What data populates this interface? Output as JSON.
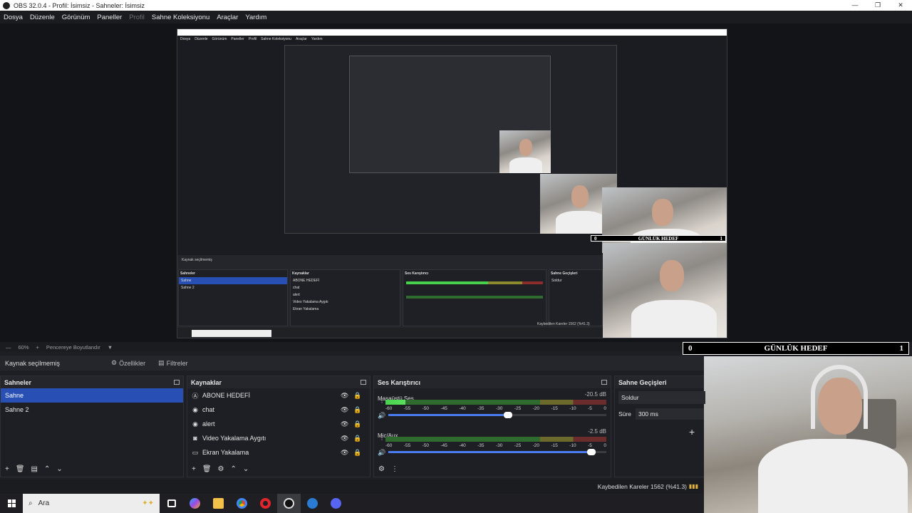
{
  "window": {
    "title": "OBS 32.0.4 - Profil: İsimsiz - Sahneler: İsimsiz",
    "controls": [
      "—",
      "❐",
      "✕"
    ]
  },
  "menu": [
    "Dosya",
    "Düzenle",
    "Görünüm",
    "Paneller",
    "Profil",
    "Sahne Koleksiyonu",
    "Araçlar",
    "Yardım"
  ],
  "preview": {
    "zoom": "60%",
    "fit": "Pencereye Boyutlandır",
    "goal_left": "0",
    "goal_title": "GÜNLÜK HEDEF",
    "goal_right": "1"
  },
  "source_bar": {
    "no_source": "Kaynak seçilmemiş",
    "properties": "Özellikler",
    "filters": "Filtreler"
  },
  "scenes": {
    "title": "Sahneler",
    "items": [
      "Sahne",
      "Sahne 2"
    ],
    "selected": 0
  },
  "sources": {
    "title": "Kaynaklar",
    "items": [
      {
        "icon": "text-icon",
        "label": "ABONE HEDEFİ"
      },
      {
        "icon": "browser-icon",
        "label": "chat"
      },
      {
        "icon": "browser-icon",
        "label": "alert"
      },
      {
        "icon": "camera-icon",
        "label": "Video Yakalama Aygıtı"
      },
      {
        "icon": "monitor-icon",
        "label": "Ekran Yakalama"
      }
    ]
  },
  "mixer": {
    "title": "Ses Karıştırıcı",
    "ticks": [
      "-60",
      "-55",
      "-50",
      "-45",
      "-40",
      "-35",
      "-30",
      "-25",
      "-20",
      "-15",
      "-10",
      "-5",
      "0"
    ],
    "channels": [
      {
        "name": "Masaüstü Ses",
        "db": "-20.5 dB",
        "level": 0.09,
        "volume": 0.55
      },
      {
        "name": "Mic/Aux",
        "db": "-2.5 dB",
        "level": 0.0,
        "volume": 0.93
      }
    ]
  },
  "transitions": {
    "title": "Sahne Geçişleri",
    "type": "Soldur",
    "duration_label": "Süre",
    "duration": "300 ms"
  },
  "status": {
    "dropped": "Kaybedilen Kareler 1562 (%41.3)"
  },
  "taskbar": {
    "search": "Ara"
  },
  "nested": {
    "menu": [
      "Dosya",
      "Düzenle",
      "Görünüm",
      "Paneller",
      "Profil",
      "Sahne Koleksiyonu",
      "Araçlar",
      "Yardım"
    ],
    "no_source": "Kaynak seçilmemiş",
    "dropped": "Kaybedilen Kareler 1562 (%41.3)"
  },
  "colors": {
    "accent": "#284fb4",
    "bg": "#1e1f24",
    "meter_green": "#47d14d"
  }
}
